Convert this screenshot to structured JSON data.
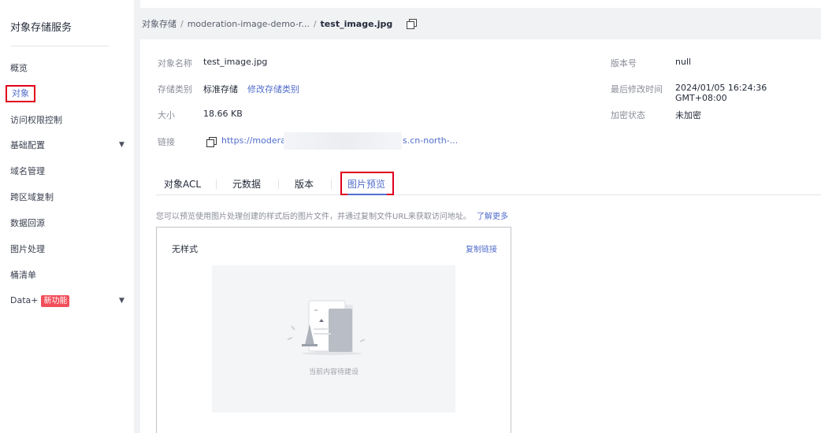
{
  "sidebar": {
    "title": "对象存储服务",
    "items": [
      {
        "label": "概览"
      },
      {
        "label": "对象"
      },
      {
        "label": "访问权限控制"
      },
      {
        "label": "基础配置"
      },
      {
        "label": "域名管理"
      },
      {
        "label": "跨区域复制"
      },
      {
        "label": "数据回源"
      },
      {
        "label": "图片处理"
      },
      {
        "label": "桶清单"
      },
      {
        "label": "Data+",
        "badge": "新功能"
      }
    ]
  },
  "breadcrumb": {
    "root": "对象存储",
    "bucket": "moderation-image-demo-r...",
    "current": "test_image.jpg"
  },
  "info": {
    "name_label": "对象名称",
    "name_value": "test_image.jpg",
    "storage_label": "存储类别",
    "storage_value": "标准存储",
    "storage_link": "修改存储类别",
    "size_label": "大小",
    "size_value": "18.66 KB",
    "link_label": "链接",
    "link_start": "https://modera",
    "link_end": "s.cn-north-...",
    "version_label": "版本号",
    "version_value": "null",
    "modified_label": "最后修改时间",
    "modified_value": "2024/01/05 16:24:36 GMT+08:00",
    "encrypt_label": "加密状态",
    "encrypt_value": "未加密"
  },
  "tabs": [
    {
      "label": "对象ACL"
    },
    {
      "label": "元数据"
    },
    {
      "label": "版本"
    },
    {
      "label": "图片预览"
    }
  ],
  "hint": {
    "text": "您可以预览使用图片处理创建的样式后的图片文件，并通过复制文件URL来获取访问地址。",
    "link": "了解更多"
  },
  "card": {
    "title": "无样式",
    "copy_label": "复制链接",
    "empty_caption": "当前内容待建设"
  },
  "colors": {
    "accent": "#526ecc",
    "highlight_border": "#e0001c",
    "badge": "#f24e59"
  }
}
